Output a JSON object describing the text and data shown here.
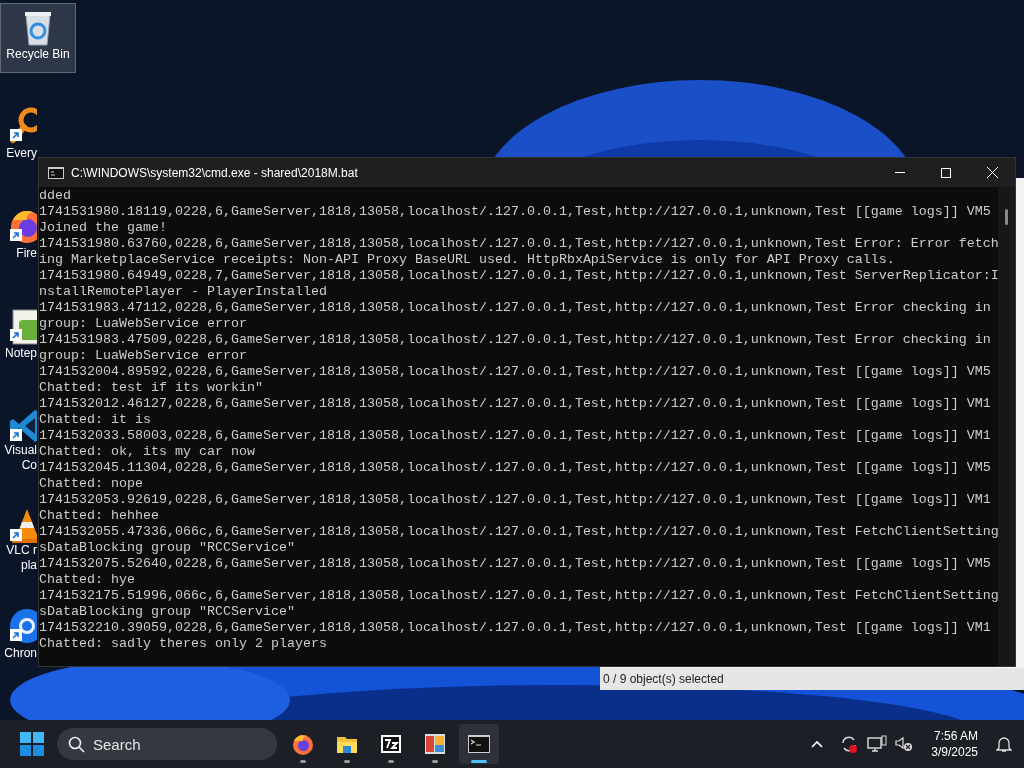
{
  "desktop_icons": [
    {
      "kind": "recycle_bin",
      "labels": [
        "Recycle Bin"
      ],
      "selected": true,
      "shortcut": false
    },
    {
      "kind": "magnifier",
      "labels": [
        "Every"
      ],
      "selected": false,
      "shortcut": true
    },
    {
      "kind": "browser",
      "labels": [
        "Fire"
      ],
      "selected": false,
      "shortcut": true
    },
    {
      "kind": "notepad",
      "labels": [
        "Notep"
      ],
      "selected": false,
      "shortcut": true
    },
    {
      "kind": "editor",
      "labels": [
        "Visual",
        "Co"
      ],
      "selected": false,
      "shortcut": true
    },
    {
      "kind": "cone",
      "labels": [
        "VLC r",
        "pla"
      ],
      "selected": false,
      "shortcut": true
    },
    {
      "kind": "globe",
      "labels": [
        "Chron"
      ],
      "selected": false,
      "shortcut": true
    }
  ],
  "background_window": {
    "status_text": "0 / 9 object(s) selected"
  },
  "console_window": {
    "title": "C:\\WINDOWS\\system32\\cmd.exe - shared\\2018M.bat",
    "lines": [
      "dded",
      "1741531980.18119,0228,6,GameServer,1818,13058,localhost/.127.0.0.1,Test,http://127.0.0.1,unknown,Test [[game logs]] VM5",
      "Joined the game!",
      "1741531980.63760,0228,6,GameServer,1818,13058,localhost/.127.0.0.1,Test,http://127.0.0.1,unknown,Test Error: Error fetch",
      "ing MarketplaceService receipts: Non-API Proxy BaseURL used. HttpRbxApiService is only for API Proxy calls.",
      "1741531980.64949,0228,7,GameServer,1818,13058,localhost/.127.0.0.1,Test,http://127.0.0.1,unknown,Test ServerReplicator:I",
      "nstallRemotePlayer - PlayerInstalled",
      "1741531983.47112,0228,6,GameServer,1818,13058,localhost/.127.0.0.1,Test,http://127.0.0.1,unknown,Test Error checking in",
      "group: LuaWebService error",
      "1741531983.47509,0228,6,GameServer,1818,13058,localhost/.127.0.0.1,Test,http://127.0.0.1,unknown,Test Error checking in",
      "group: LuaWebService error",
      "1741532004.89592,0228,6,GameServer,1818,13058,localhost/.127.0.0.1,Test,http://127.0.0.1,unknown,Test [[game logs]] VM5",
      "Chatted: test if its workin\"",
      "1741532012.46127,0228,6,GameServer,1818,13058,localhost/.127.0.0.1,Test,http://127.0.0.1,unknown,Test [[game logs]] VM1",
      "Chatted: it is",
      "1741532033.58003,0228,6,GameServer,1818,13058,localhost/.127.0.0.1,Test,http://127.0.0.1,unknown,Test [[game logs]] VM1",
      "Chatted: ok, its my car now",
      "1741532045.11304,0228,6,GameServer,1818,13058,localhost/.127.0.0.1,Test,http://127.0.0.1,unknown,Test [[game logs]] VM5",
      "Chatted: nope",
      "1741532053.92619,0228,6,GameServer,1818,13058,localhost/.127.0.0.1,Test,http://127.0.0.1,unknown,Test [[game logs]] VM1",
      "Chatted: hehhee",
      "1741532055.47336,066c,6,GameServer,1818,13058,localhost/.127.0.0.1,Test,http://127.0.0.1,unknown,Test FetchClientSetting",
      "sDataBlocking group \"RCCService\"",
      "1741532075.52640,0228,6,GameServer,1818,13058,localhost/.127.0.0.1,Test,http://127.0.0.1,unknown,Test [[game logs]] VM5",
      "Chatted: hye",
      "1741532175.51996,066c,6,GameServer,1818,13058,localhost/.127.0.0.1,Test,http://127.0.0.1,unknown,Test FetchClientSetting",
      "sDataBlocking group \"RCCService\"",
      "1741532210.39059,0228,6,GameServer,1818,13058,localhost/.127.0.0.1,Test,http://127.0.0.1,unknown,Test [[game logs]] VM1",
      "Chatted: sadly theres only 2 players"
    ]
  },
  "taskbar": {
    "search": {
      "placeholder": "Search"
    },
    "apps": [
      {
        "kind": "browser",
        "selected": false
      },
      {
        "kind": "folder",
        "selected": false
      },
      {
        "kind": "archiver",
        "selected": false
      },
      {
        "kind": "control_panel",
        "selected": false
      },
      {
        "kind": "terminal",
        "selected": true
      }
    ],
    "clock": {
      "time": "7:56 AM",
      "date": "3/9/2025"
    }
  }
}
